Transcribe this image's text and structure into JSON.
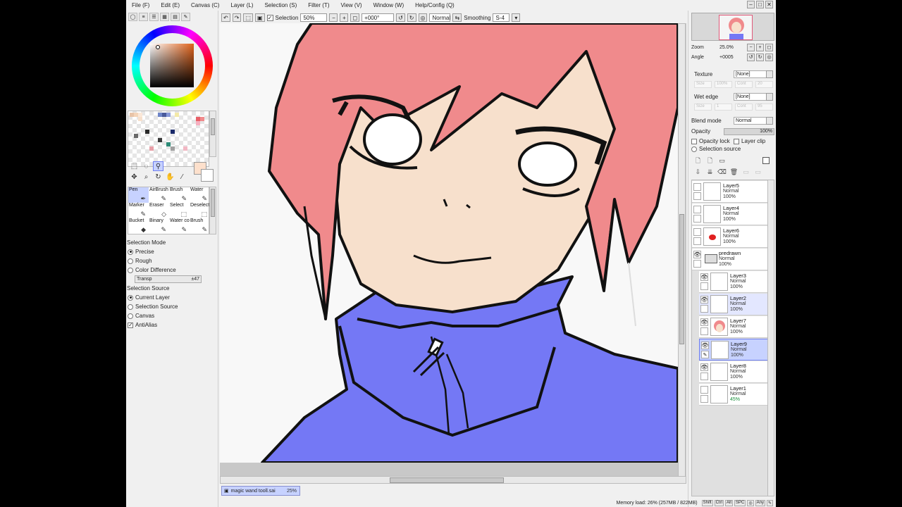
{
  "menu": [
    "File (F)",
    "Edit (E)",
    "Canvas (C)",
    "Layer (L)",
    "Selection (S)",
    "Filter (T)",
    "View (V)",
    "Window (W)",
    "Help/Config (Q)"
  ],
  "window_controls": [
    "–",
    "□",
    "✕"
  ],
  "toolbar": {
    "selection_label": "Selection",
    "selection_checked": true,
    "zoom_value": "50%",
    "angle_value": "+000°",
    "blend_value": "Normal",
    "smoothing_label": "Smoothing",
    "smoothing_value": "S-4"
  },
  "left_tabs": [
    "◯",
    "≡",
    "☰",
    "▦",
    "▤",
    "✎"
  ],
  "tools": [
    {
      "label": "Pen",
      "icon": "pen-icon"
    },
    {
      "label": "AirBrush",
      "icon": "airbrush-icon"
    },
    {
      "label": "Brush",
      "icon": "brush-icon"
    },
    {
      "label": "Water",
      "icon": "water-icon"
    },
    {
      "label": "Marker",
      "icon": "marker-icon"
    },
    {
      "label": "Eraser",
      "icon": "eraser-icon"
    },
    {
      "label": "Select",
      "icon": "select-icon"
    },
    {
      "label": "Deselect",
      "icon": "deselect-icon"
    },
    {
      "label": "Bucket",
      "icon": "bucket-icon"
    },
    {
      "label": "Binary",
      "icon": "binary-icon"
    },
    {
      "label": "Water co",
      "icon": "watercolor-icon"
    },
    {
      "label": "Brush",
      "icon": "brush2-icon"
    }
  ],
  "selection_mode": {
    "title": "Selection Mode",
    "options": [
      "Precise",
      "Rough",
      "Color Difference"
    ],
    "selected": 0,
    "slider_label": "Transp",
    "slider_value": "±47"
  },
  "selection_source": {
    "title": "Selection Source",
    "options": [
      "Current Layer",
      "Selection Source",
      "Canvas"
    ],
    "selected": 0,
    "antialias_label": "AntiAlias",
    "antialias_checked": true
  },
  "document_tab": {
    "name": "magic wand tooll.sai",
    "zoom": "25%"
  },
  "navigator": {
    "zoom_label": "Zoom",
    "zoom_value": "25.0%",
    "angle_label": "Angle",
    "angle_value": "+0005"
  },
  "brush_props": {
    "texture_label": "Texture",
    "texture_value": "[None]",
    "texture_sub": [
      "Size",
      "100%",
      "Cont",
      "20"
    ],
    "wetedge_label": "Wet edge",
    "wetedge_value": "[None]",
    "wetedge_sub": [
      "Size",
      "1",
      "Cont",
      "95"
    ]
  },
  "layer_props": {
    "blend_label": "Blend mode",
    "blend_value": "Normal",
    "opacity_label": "Opacity",
    "opacity_value": "100%",
    "opacity_lock": "Opacity lock",
    "layer_clip": "Layer clip",
    "selection_source": "Selection source"
  },
  "layers": [
    {
      "name": "Layer5",
      "mode": "Normal",
      "opacity": "100%",
      "visible": false,
      "indent": false,
      "state": ""
    },
    {
      "name": "Layer4",
      "mode": "Normal",
      "opacity": "100%",
      "visible": false,
      "indent": false,
      "state": ""
    },
    {
      "name": "Layer6",
      "mode": "Normal",
      "opacity": "100%",
      "visible": false,
      "indent": false,
      "state": ""
    },
    {
      "name": "predrawn",
      "mode": "Normal",
      "opacity": "100%",
      "visible": true,
      "indent": false,
      "state": "folder"
    },
    {
      "name": "Layer3",
      "mode": "Normal",
      "opacity": "100%",
      "visible": true,
      "indent": true,
      "state": ""
    },
    {
      "name": "Layer2",
      "mode": "Normal",
      "opacity": "100%",
      "visible": true,
      "indent": true,
      "state": "hl"
    },
    {
      "name": "Layer7",
      "mode": "Normal",
      "opacity": "100%",
      "visible": true,
      "indent": true,
      "state": ""
    },
    {
      "name": "Layer9",
      "mode": "Normal",
      "opacity": "100%",
      "visible": true,
      "indent": true,
      "state": "sel"
    },
    {
      "name": "Layer8",
      "mode": "Normal",
      "opacity": "100%",
      "visible": true,
      "indent": true,
      "state": ""
    },
    {
      "name": "Layer1",
      "mode": "Normal",
      "opacity": "45%",
      "visible": false,
      "indent": true,
      "state": "green"
    }
  ],
  "status": {
    "memory": "Memory load: 26% (257MB / 822MB)",
    "keys": [
      "Shift",
      "Ctrl",
      "Alt",
      "SPC",
      "◎",
      "Any",
      "✎"
    ]
  },
  "colors": {
    "hair": "#f08a8c",
    "skin": "#f7e0cc",
    "jacket": "#7478f5",
    "line": "#111111",
    "foreground": "#fde0cc",
    "selection_highlight": "#c7d2ff"
  }
}
